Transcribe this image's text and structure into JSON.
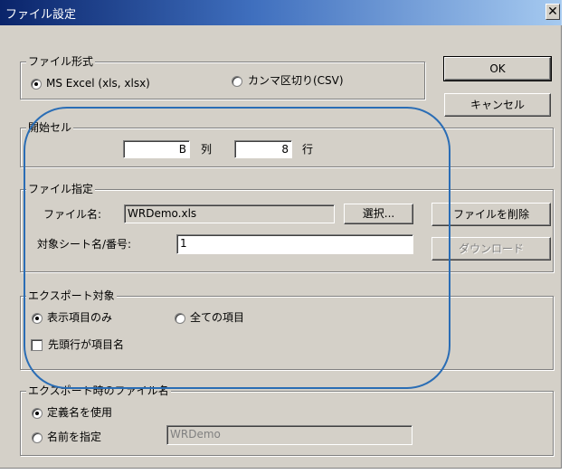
{
  "window": {
    "title": "ファイル設定",
    "close_glyph": "✕"
  },
  "buttons": {
    "ok": "OK",
    "cancel": "キャンセル"
  },
  "file_format": {
    "title": "ファイル形式",
    "option_excel": "MS Excel (xls, xlsx)",
    "option_csv": "カンマ区切り(CSV)",
    "selected": "excel"
  },
  "start_cell": {
    "title": "開始セル",
    "column_value": "B",
    "column_label": "列",
    "row_value": "8",
    "row_label": "行"
  },
  "file_spec": {
    "title": "ファイル指定",
    "filename_label": "ファイル名:",
    "filename_value": "WRDemo.xls",
    "select_button": "選択...",
    "delete_button": "ファイルを削除",
    "sheet_label": "対象シート名/番号:",
    "sheet_value": "1",
    "download_button": "ダウンロード"
  },
  "export_target": {
    "title": "エクスポート対象",
    "option_visible": "表示項目のみ",
    "option_all": "全ての項目",
    "selected": "visible",
    "header_row_label": "先頭行が項目名",
    "header_row_checked": false
  },
  "export_filename": {
    "title": "エクスポート時のファイル名",
    "option_defined": "定義名を使用",
    "option_specify": "名前を指定",
    "selected": "defined",
    "name_value": "WRDemo"
  },
  "colors": {
    "annotation": "#2a6db5"
  }
}
